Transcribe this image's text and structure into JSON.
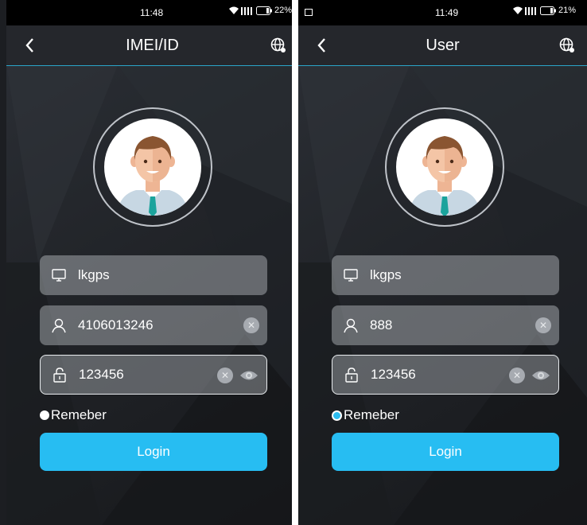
{
  "left_screen": {
    "status": {
      "time": "11:48",
      "battery": "22%"
    },
    "title": "IMEI/ID",
    "server_value": "lkgps",
    "account_value": "4106013246",
    "password_value": "123456",
    "remember_label": "Remeber",
    "remember_checked": false,
    "login_label": "Login"
  },
  "right_screen": {
    "status": {
      "time": "11:49",
      "battery": "21%"
    },
    "title": "User",
    "server_value": "lkgps",
    "account_value": "888",
    "password_value": "123456",
    "remember_label": "Remeber",
    "remember_checked": true,
    "login_label": "Login"
  },
  "colors": {
    "accent": "#27bdf2",
    "navbar_line": "#2aa4c9",
    "field_bg": "#8f949b"
  },
  "icons": [
    "back-arrow-icon",
    "globe-icon",
    "monitor-icon",
    "user-icon",
    "lock-icon",
    "clear-icon",
    "eye-icon",
    "wifi-icon",
    "signal-icon",
    "battery-icon"
  ]
}
